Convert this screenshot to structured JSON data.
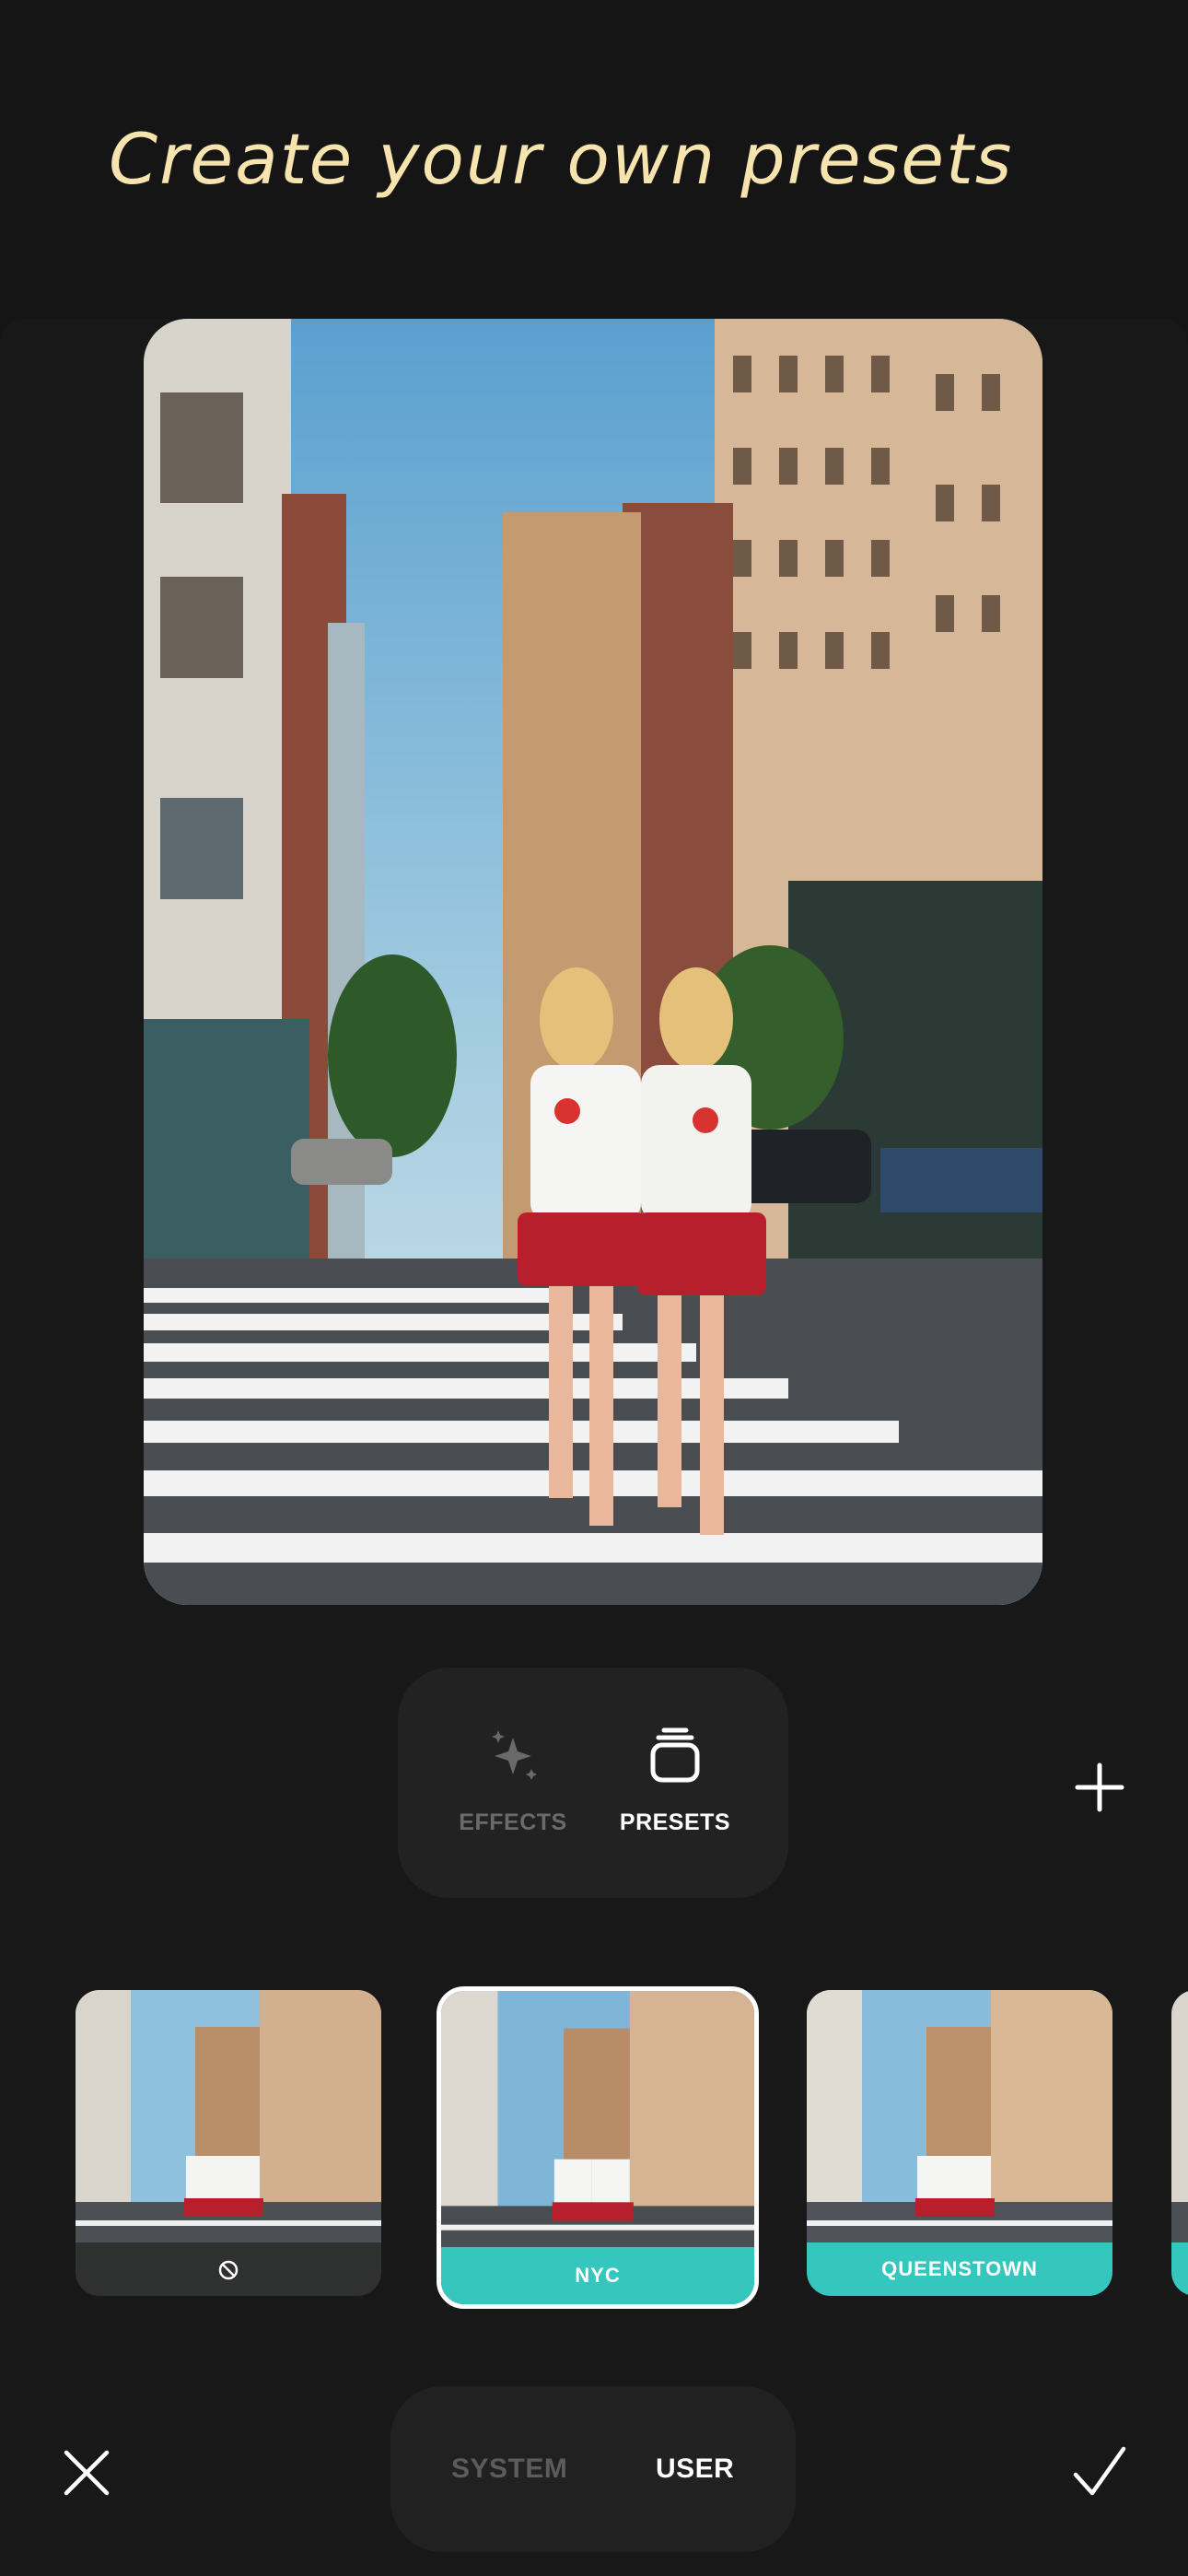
{
  "header": {
    "title": "Create your own presets"
  },
  "preview": {
    "alt": "Preview photo"
  },
  "mode_tabs": [
    {
      "label": "EFFECTS",
      "icon": "sparkle-icon",
      "active": false
    },
    {
      "label": "PRESETS",
      "icon": "stack-icon",
      "active": true
    }
  ],
  "add_button": {
    "icon": "plus-icon"
  },
  "presets": [
    {
      "label": "",
      "icon": "none-icon",
      "selected": false
    },
    {
      "label": "NYC",
      "selected": true
    },
    {
      "label": "QUEENSTOWN",
      "selected": false
    }
  ],
  "collection_tabs": [
    {
      "label": "SYSTEM",
      "active": false
    },
    {
      "label": "USER",
      "active": true
    }
  ],
  "actions": {
    "cancel_icon": "close-icon",
    "confirm_icon": "checkmark-icon"
  },
  "colors": {
    "background": "#151515",
    "title": "#f6e3ae",
    "accent": "#35c7bd",
    "inactive_text": "#6a6a6a"
  }
}
